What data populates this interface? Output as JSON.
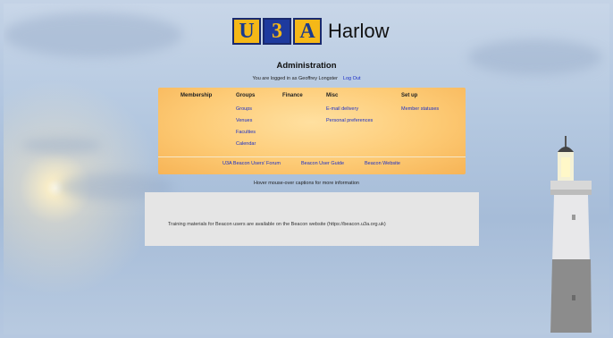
{
  "header": {
    "logo_letters": [
      "U",
      "3",
      "A"
    ],
    "site_name": "Harlow"
  },
  "admin": {
    "title": "Administration",
    "logged_in_text": "You are logged in as Geoffrey Longster",
    "logout_label": "Log Out"
  },
  "menu": {
    "columns": [
      {
        "heading": "Membership",
        "items": []
      },
      {
        "heading": "Groups",
        "items": [
          "Groups",
          "Venues",
          "Faculties",
          "Calendar"
        ]
      },
      {
        "heading": "Finance",
        "items": []
      },
      {
        "heading": "Misc",
        "items": [
          "E-mail delivery",
          "Personal preferences"
        ]
      },
      {
        "heading": "Set up",
        "items": [
          "Member statuses"
        ]
      }
    ],
    "footer_links": [
      "U3A Beacon Users' Forum",
      "Beacon User Guide",
      "Beacon Website"
    ]
  },
  "hover_note": "Hover mouse-over captions for more information",
  "info_text": "Training materials for Beacon users are available on the Beacon website (https://beacon.u3a.org.uk)",
  "colors": {
    "menu_bg": "#fdcb76",
    "link": "#1a2fc7",
    "info_bg": "#e5e5e5",
    "logo_yellow": "#f5b818",
    "logo_blue": "#1e3a9e"
  }
}
